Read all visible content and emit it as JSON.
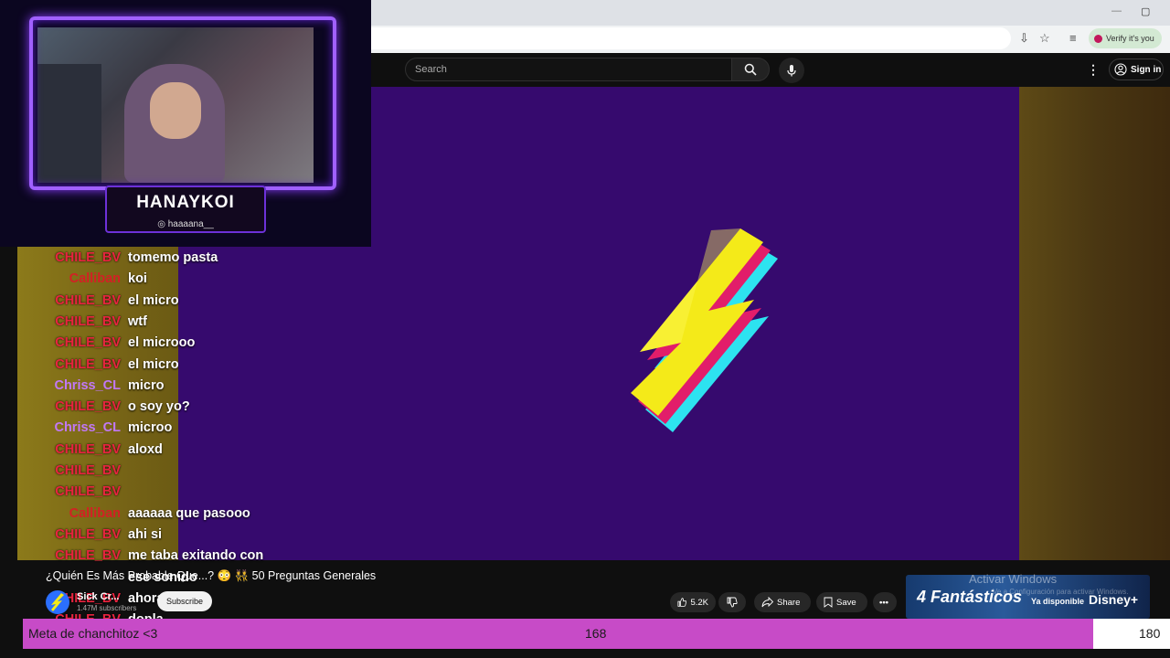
{
  "browser": {
    "verify_label": "Verify it's you"
  },
  "header": {
    "search_placeholder": "Search",
    "signin_label": "Sign in"
  },
  "webcam": {
    "name": "HANAYKOI",
    "handle": "haaaana__"
  },
  "chat": {
    "messages": [
      {
        "user": "CHILE_BV",
        "text": "tomemo pasta",
        "type": "chile"
      },
      {
        "user": "Calliban",
        "text": "koi",
        "type": "calliban"
      },
      {
        "user": "CHILE_BV",
        "text": "el micro",
        "type": "chile"
      },
      {
        "user": "CHILE_BV",
        "text": "wtf",
        "type": "chile"
      },
      {
        "user": "CHILE_BV",
        "text": "el microoo",
        "type": "chile"
      },
      {
        "user": "CHILE_BV",
        "text": "el micro",
        "type": "chile"
      },
      {
        "user": "Chriss_CL",
        "text": "micro",
        "type": "chriss"
      },
      {
        "user": "CHILE_BV",
        "text": "o soy yo?",
        "type": "chile"
      },
      {
        "user": "Chriss_CL",
        "text": "microo",
        "type": "chriss"
      },
      {
        "user": "CHILE_BV",
        "text": "aloxd",
        "type": "chile"
      },
      {
        "user": "CHILE_BV",
        "text": "",
        "type": "chile"
      },
      {
        "user": "CHILE_BV",
        "text": "",
        "type": "chile"
      },
      {
        "user": "Calliban",
        "text": "aaaaaa que pasooo",
        "type": "calliban"
      },
      {
        "user": "CHILE_BV",
        "text": "ahi si",
        "type": "chile"
      },
      {
        "user": "CHILE_BV",
        "text": "me taba exitando con",
        "type": "chile"
      },
      {
        "user": "",
        "text": "ese sonido",
        "type": "chile"
      },
      {
        "user": "CHILE_BV",
        "text": "ahora si",
        "type": "chile"
      },
      {
        "user": "CHILE_BV",
        "text": "dopla",
        "type": "chile"
      }
    ]
  },
  "video": {
    "title": "¿Quién Es Más Probable Que...? 😳 👯 50 Preguntas Generales",
    "channel": "Sick Cr...",
    "subscribers": "1.47M subscribers",
    "subscribe_label": "Subscribe",
    "like_count": "5.2K",
    "share_label": "Share",
    "save_label": "Save"
  },
  "ad": {
    "title": "4 Fantásticos",
    "subtitle": "Ya disponible",
    "brand": "Disney+"
  },
  "overlay": {
    "activate_windows": "Activar Windows",
    "activate_sub": "Ve a Configuración para activar Windows."
  },
  "goal": {
    "label": "Meta de chanchitoz <3",
    "current": 168,
    "target": 180,
    "current_text": "168",
    "target_text": "180",
    "fill_color": "#c74bc7"
  },
  "colors": {
    "video_bg": "#360a6e",
    "chat_user_chile": "#e8243f",
    "chat_user_chriss": "#c178f5",
    "frame_accent": "#a060ff"
  }
}
